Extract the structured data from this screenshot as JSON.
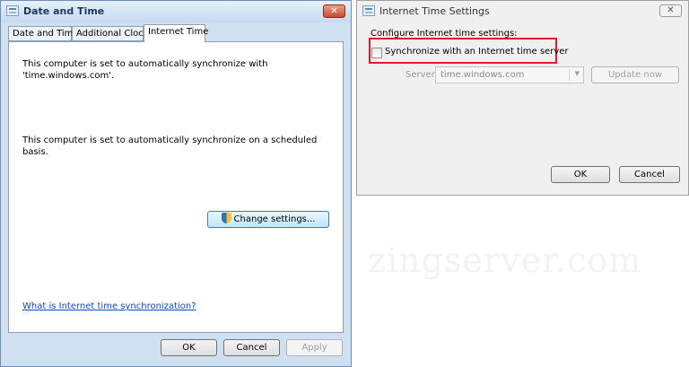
{
  "left_window": {
    "title": "Date and Time",
    "close_glyph": "✕",
    "tabs": [
      "Date and Time",
      "Additional Clocks",
      "Internet Time"
    ],
    "active_tab": "Internet Time",
    "sync_message": "This computer is set to automatically synchronize with",
    "sync_server_line": "'time.windows.com'.",
    "schedule_message": "This computer is set to automatically synchronize on a scheduled basis.",
    "change_settings_label": "Change settings...",
    "help_link": "What is Internet time synchronization?",
    "ok_label": "OK",
    "cancel_label": "Cancel",
    "apply_label": "Apply"
  },
  "right_window": {
    "title": "Internet Time Settings",
    "close_glyph": "✕",
    "configure_label": "Configure Internet time settings:",
    "sync_checkbox_label": "Synchronize with an Internet time server",
    "sync_checked": false,
    "server_label": "Server:",
    "server_value": "time.windows.com",
    "update_now_label": "Update now",
    "ok_label": "OK",
    "cancel_label": "Cancel",
    "highlight_color": "#e31b23"
  },
  "watermark": "zingserver.com",
  "icons": [
    "calendar-clock-icon",
    "close-icon",
    "uac-shield-icon",
    "chevron-down-icon"
  ]
}
